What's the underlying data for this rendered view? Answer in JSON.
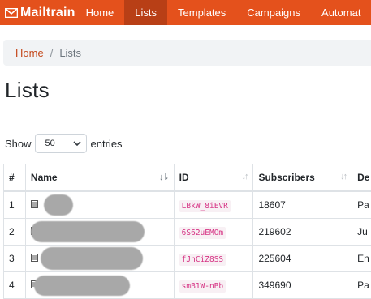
{
  "nav": {
    "brand": "Mailtrain",
    "items": [
      {
        "label": "Home",
        "active": false
      },
      {
        "label": "Lists",
        "active": true
      },
      {
        "label": "Templates",
        "active": false
      },
      {
        "label": "Campaigns",
        "active": false
      },
      {
        "label": "Automat",
        "active": false
      }
    ]
  },
  "breadcrumb": {
    "home": "Home",
    "separator": "/",
    "current": "Lists"
  },
  "page": {
    "title": "Lists"
  },
  "entries": {
    "show_label": "Show",
    "selected": "50",
    "suffix_label": "entries"
  },
  "table": {
    "headers": {
      "num": "#",
      "name": "Name",
      "id": "ID",
      "subscribers": "Subscribers",
      "description": "De"
    },
    "rows": [
      {
        "num": "1",
        "id": "LBkW_8iEVR",
        "subscribers": "18607",
        "description": "Pa"
      },
      {
        "num": "2",
        "id": "6S62uEMOm",
        "subscribers": "219602",
        "description": "Ju"
      },
      {
        "num": "3",
        "id": "fJnCiZ8SS",
        "subscribers": "225604",
        "description": "En"
      },
      {
        "num": "4",
        "id": "smB1W-nBb",
        "subscribers": "349690",
        "description": "Pa"
      }
    ]
  },
  "colors": {
    "navbar": "#e4511c",
    "navbar_active": "#b83f16",
    "link": "#c4471a",
    "code": "#d63384"
  }
}
